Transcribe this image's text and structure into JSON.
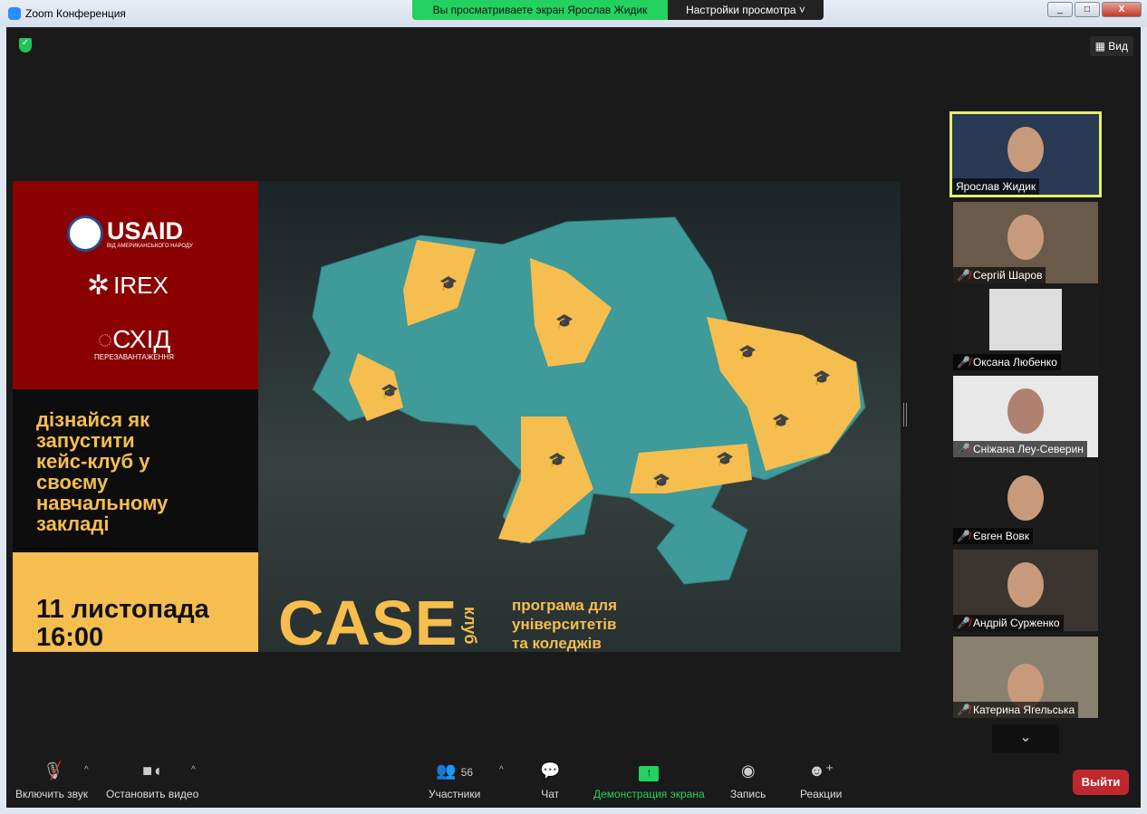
{
  "window": {
    "title": "Zoom Конференция",
    "banner": "Вы просматриваете экран Ярослав Жидик",
    "view_settings": "Настройки просмотра",
    "view_button": "Вид"
  },
  "slide": {
    "logo_usaid": "USAID",
    "usaid_sub": "ВІД АМЕРИКАНСЬКОГО НАРОДУ",
    "logo_irex": "IREX",
    "logo_skhid": "СХІД",
    "skhid_sub": "ПЕРЕЗАВАНТАЖЕННЯ",
    "headline": [
      "дізнайся як",
      "запустити",
      "кейс-клуб у",
      "своєму",
      "навчальному",
      "закладі"
    ],
    "date": "11 листопада",
    "time": "16:00",
    "case": "CASE",
    "klub": "клуб",
    "program": [
      "програма для",
      "університетів",
      "та коледжів"
    ]
  },
  "participants": [
    {
      "name": "Ярослав Жидик",
      "muted": false,
      "active": true
    },
    {
      "name": "Сергій Шаров",
      "muted": true
    },
    {
      "name": "Оксана Любенко",
      "muted": true
    },
    {
      "name": "Сніжана Леу-Северин",
      "muted": true
    },
    {
      "name": "Євген Вовк",
      "muted": true
    },
    {
      "name": "Андрій Сурженко",
      "muted": true
    },
    {
      "name": "Катерина Ягельська",
      "muted": true
    }
  ],
  "toolbar": {
    "unmute": "Включить звук",
    "stop_video": "Остановить видео",
    "participants": "Участники",
    "participants_count": "56",
    "chat": "Чат",
    "share": "Демонстрация экрана",
    "record": "Запись",
    "reactions": "Реакции",
    "leave": "Выйти"
  },
  "colors": {
    "accent_green": "#23d160",
    "slide_red": "#8b0000",
    "slide_yellow": "#f6bd4f",
    "map_teal": "#3f9a9a",
    "leave_red": "#c0282d"
  }
}
